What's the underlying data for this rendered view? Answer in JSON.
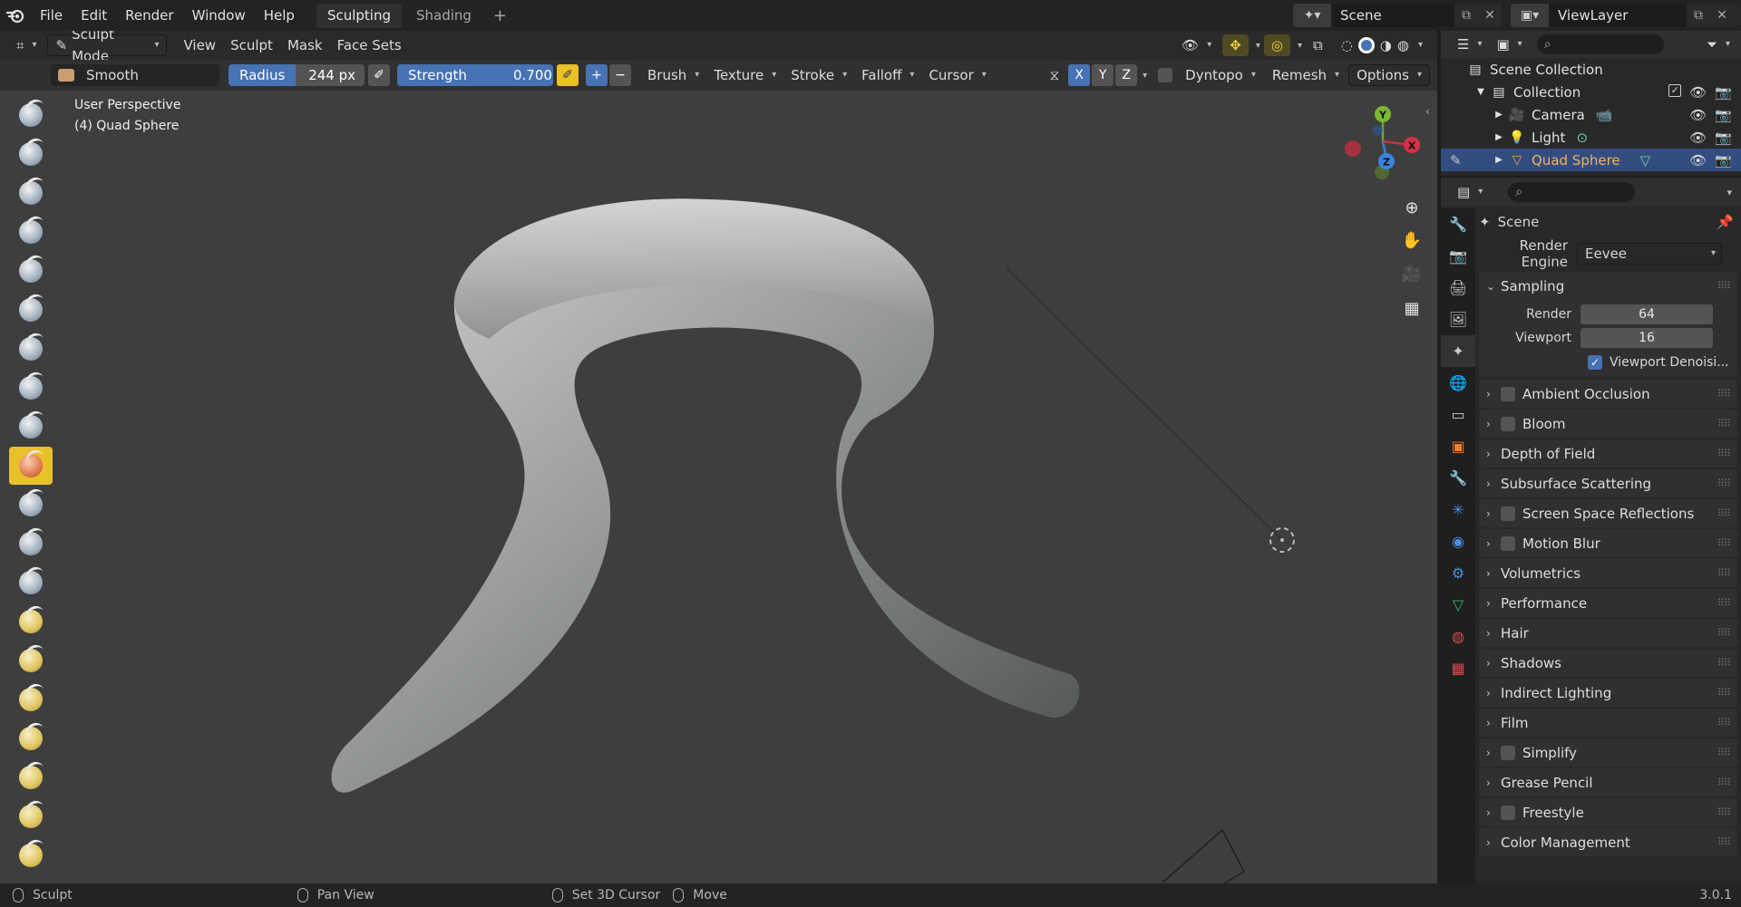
{
  "menu": {
    "items": [
      "File",
      "Edit",
      "Render",
      "Window",
      "Help"
    ]
  },
  "workspaces": {
    "tabs": [
      "Sculpting",
      "Shading"
    ],
    "active": "Sculpting"
  },
  "scene_selector": {
    "value": "Scene"
  },
  "viewlayer_selector": {
    "value": "ViewLayer"
  },
  "vp_header": {
    "mode": "Sculpt Mode",
    "menus": [
      "View",
      "Sculpt",
      "Mask",
      "Face Sets"
    ]
  },
  "tool_header": {
    "brush_name": "Smooth",
    "radius_label": "Radius",
    "radius_value": "244 px",
    "strength_label": "Strength",
    "strength_value": "0.700",
    "plus": "+",
    "minus": "−",
    "dropdowns": [
      "Brush",
      "Texture",
      "Stroke",
      "Falloff",
      "Cursor"
    ],
    "axes": [
      "X",
      "Y",
      "Z"
    ],
    "dyntopo": "Dyntopo",
    "remesh": "Remesh",
    "options": "Options"
  },
  "viewport": {
    "perspective": "User Perspective",
    "object": "(4) Quad Sphere"
  },
  "gizmo": {
    "y": "Y",
    "x": "X",
    "z": "Z"
  },
  "outliner": {
    "root": "Scene Collection",
    "collection": "Collection",
    "items": [
      "Camera",
      "Light",
      "Quad Sphere"
    ],
    "selected": "Quad Sphere"
  },
  "properties": {
    "context": "Scene",
    "render_engine_label": "Render Engine",
    "render_engine_value": "Eevee",
    "sampling": {
      "title": "Sampling",
      "render_label": "Render",
      "render_value": "64",
      "viewport_label": "Viewport",
      "viewport_value": "16",
      "denoise_label": "Viewport Denoisi..."
    },
    "panels": [
      {
        "label": "Ambient Occlusion",
        "checkbox": true
      },
      {
        "label": "Bloom",
        "checkbox": true
      },
      {
        "label": "Depth of Field",
        "checkbox": false
      },
      {
        "label": "Subsurface Scattering",
        "checkbox": false
      },
      {
        "label": "Screen Space Reflections",
        "checkbox": true
      },
      {
        "label": "Motion Blur",
        "checkbox": true
      },
      {
        "label": "Volumetrics",
        "checkbox": false
      },
      {
        "label": "Performance",
        "checkbox": false
      },
      {
        "label": "Hair",
        "checkbox": false
      },
      {
        "label": "Shadows",
        "checkbox": false
      },
      {
        "label": "Indirect Lighting",
        "checkbox": false
      },
      {
        "label": "Film",
        "checkbox": false
      },
      {
        "label": "Simplify",
        "checkbox": true
      },
      {
        "label": "Grease Pencil",
        "checkbox": false
      },
      {
        "label": "Freestyle",
        "checkbox": true
      },
      {
        "label": "Color Management",
        "checkbox": false
      }
    ]
  },
  "statusbar": {
    "sculpt": "Sculpt",
    "pan": "Pan View",
    "cursor": "Set 3D Cursor",
    "move": "Move",
    "version": "3.0.1"
  },
  "colors": {
    "accent": "#4772b3",
    "active_tool": "#e8c12a",
    "selected_row": "#334d80"
  }
}
